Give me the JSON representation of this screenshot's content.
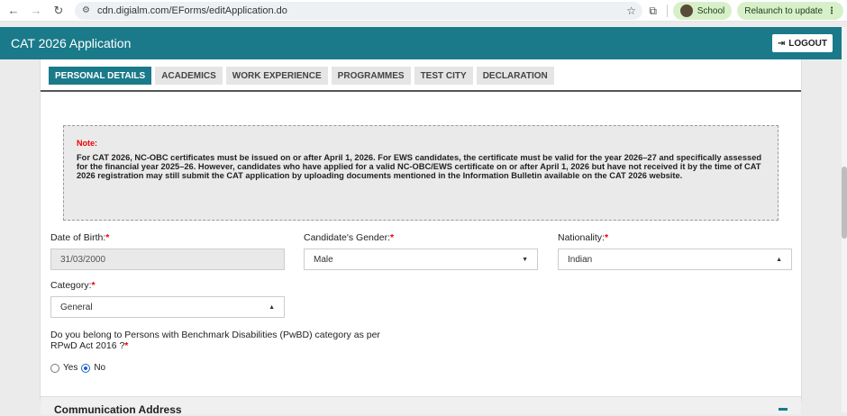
{
  "browser": {
    "url": "cdn.digialm.com/EForms/editApplication.do",
    "profile_label": "School",
    "relaunch_label": "Relaunch to update"
  },
  "header": {
    "title": "CAT 2026 Application",
    "logout_label": "LOGOUT"
  },
  "tabs": [
    {
      "label": "PERSONAL DETAILS",
      "active": true
    },
    {
      "label": "ACADEMICS",
      "active": false
    },
    {
      "label": "WORK EXPERIENCE",
      "active": false
    },
    {
      "label": "PROGRAMMES",
      "active": false
    },
    {
      "label": "TEST CITY",
      "active": false
    },
    {
      "label": "DECLARATION",
      "active": false
    }
  ],
  "note": {
    "title": "Note:",
    "body": "For CAT 2026, NC-OBC certificates must be issued on or after April 1, 2026. For EWS candidates, the certificate must be valid for the year 2026–27 and specifically assessed for the financial year 2025–26. However, candidates who have applied for a valid NC-OBC/EWS certificate on or after April 1, 2026 but have not received it by the time of CAT 2026 registration may still submit the CAT application by uploading documents mentioned in the Information Bulletin available on the CAT 2026 website."
  },
  "form": {
    "dob": {
      "label": "Date of Birth:",
      "value": "31/03/2000"
    },
    "gender": {
      "label": "Candidate's Gender:",
      "value": "Male"
    },
    "nationality": {
      "label": "Nationality:",
      "value": "Indian"
    },
    "category": {
      "label": "Category:",
      "value": "General"
    },
    "pwbd": {
      "question": "Do you belong to Persons with Benchmark Disabilities (PwBD) category as per RPwD Act 2016 ?",
      "options": [
        "Yes",
        "No"
      ],
      "selected": "No"
    },
    "required_mark": "*"
  },
  "section": {
    "communication_title": "Communication Address"
  },
  "colors": {
    "accent": "#1a7a8a",
    "required": "#e00000"
  }
}
